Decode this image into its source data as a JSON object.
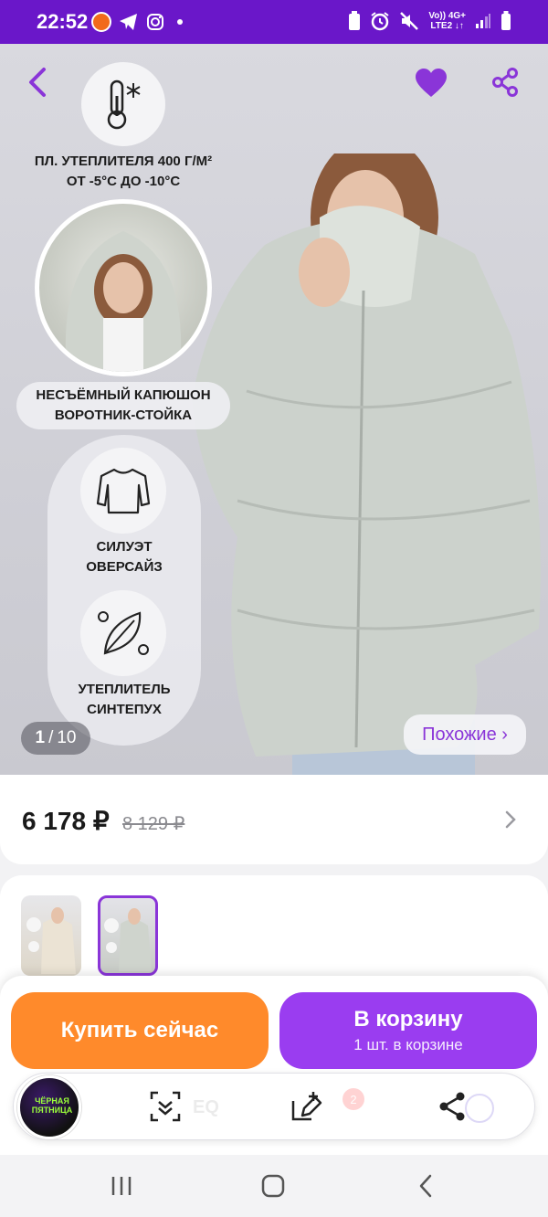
{
  "status_bar": {
    "time": "22:52",
    "network_top": "Vo)) 4G+",
    "network_bottom": "LTE2 ↓↑"
  },
  "hero": {
    "features": [
      {
        "line1": "ПЛ. УТЕПЛИТЕЛЯ 400 Г/М²",
        "line2": "ОТ -5°C ДО -10°C",
        "icon": "thermometer-snowflake-icon"
      },
      {
        "line1": "НЕСЪЁМНЫЙ КАПЮШОН",
        "line2": "ВОРОТНИК-СТОЙКА"
      },
      {
        "line1": "СИЛУЭТ",
        "line2": "ОВЕРСАЙЗ",
        "icon": "sweater-icon"
      },
      {
        "line1": "УТЕПЛИТЕЛЬ",
        "line2": "СИНТЕПУХ",
        "icon": "feather-icon"
      }
    ],
    "counter_current": "1",
    "counter_sep": "/",
    "counter_total": "10",
    "similar_label": "Похожие ›"
  },
  "price": {
    "current": "6 178 ₽",
    "old": "8 129 ₽"
  },
  "thumbnails": {
    "count": 2,
    "selected_index": 1
  },
  "actions": {
    "buy_now": "Купить сейчас",
    "add_to_cart": "В корзину",
    "in_cart": "1 шт. в корзине"
  },
  "toolbar": {
    "promo": "ЧЁРНАЯ ПЯТНИЦА",
    "ghost_search": "EQ",
    "cart_badge": "2"
  },
  "colors": {
    "brand_purple": "#9a3df0",
    "status_bar": "#6a17c9",
    "buy_orange": "#ff8a2b"
  }
}
